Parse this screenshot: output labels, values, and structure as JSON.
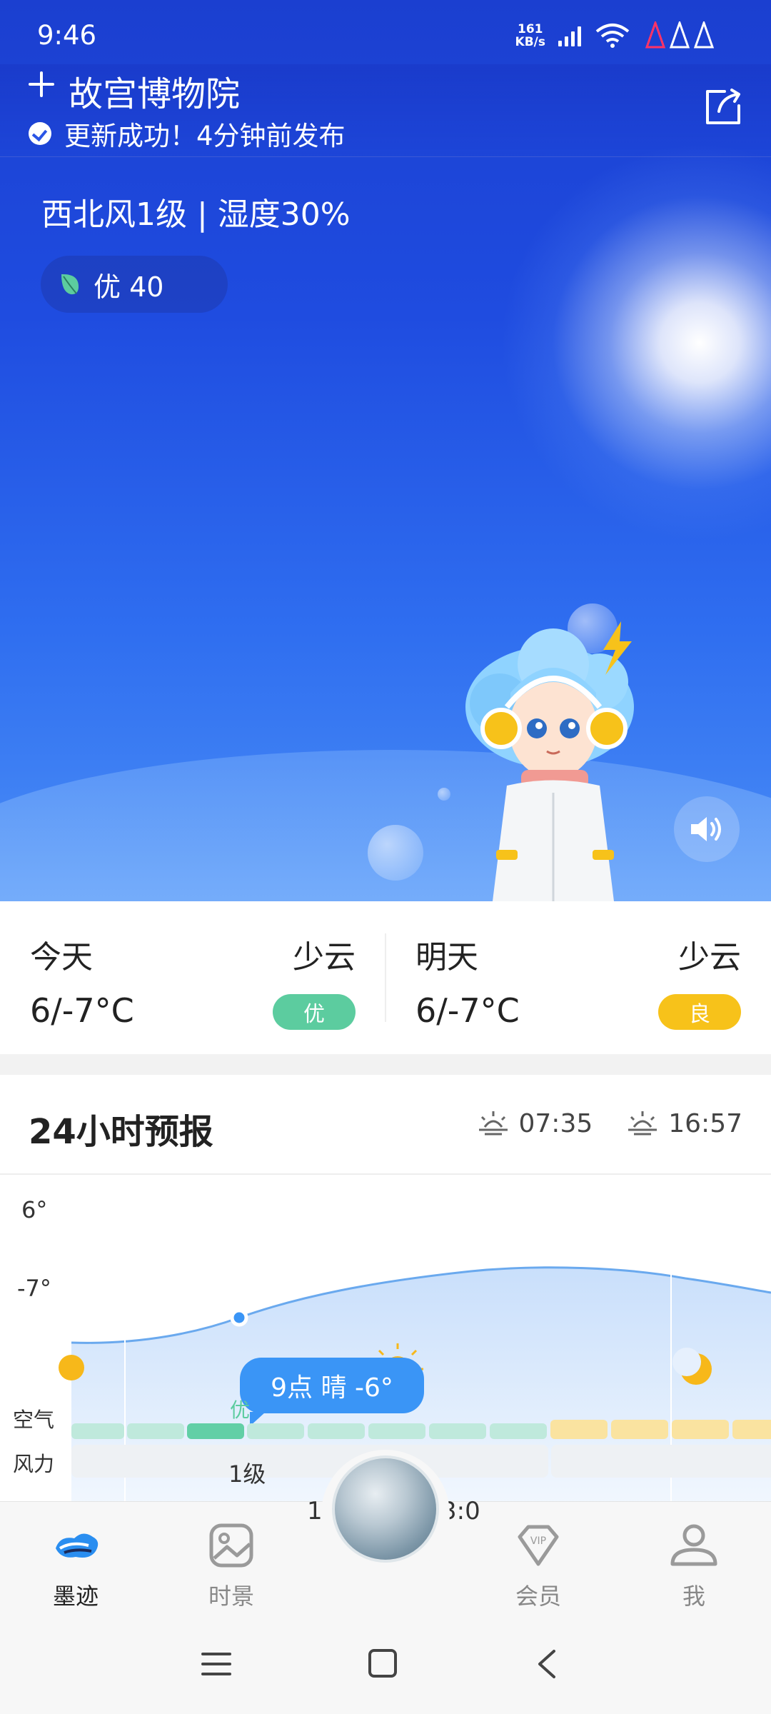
{
  "status_bar": {
    "time": "9:46",
    "net_speed_value": "161",
    "net_speed_unit": "KB/s"
  },
  "header": {
    "location": "故宫博物院",
    "update_status": "更新成功！4分钟前发布"
  },
  "current": {
    "wind_humidity": "西北风1级 | 湿度30%",
    "aqi_label": "优 40"
  },
  "days": [
    {
      "name": "今天",
      "condition": "少云",
      "temp": "6/-7°C",
      "aqi": "优",
      "aqi_color": "#5ccc9f"
    },
    {
      "name": "明天",
      "condition": "少云",
      "temp": "6/-7°C",
      "aqi": "良",
      "aqi_color": "#f7c21a"
    }
  ],
  "forecast": {
    "title": "24小时预报",
    "sunrise": "07:35",
    "sunset": "16:57",
    "y_high": "6°",
    "y_low": "-7°",
    "tooltip": "9点 晴 -6°",
    "air_row_label": "空气",
    "air_selected": "优",
    "wind_row_label": "风力",
    "wind_value": "1级",
    "peek_left": "11",
    "peek_right": "3:0",
    "colors": {
      "air_good": "#bfe9dc",
      "air_good_selected": "#62cfa6",
      "air_moderate": "#fae3a0",
      "curve_fill": "#d7e8fc",
      "curve_line": "#6aa9ee"
    }
  },
  "nav": {
    "items": [
      {
        "label": "墨迹",
        "icon": "moji-logo-icon"
      },
      {
        "label": "时景",
        "icon": "picture-icon"
      },
      {
        "label": "会员",
        "icon": "vip-icon"
      },
      {
        "label": "我",
        "icon": "user-icon"
      }
    ]
  }
}
